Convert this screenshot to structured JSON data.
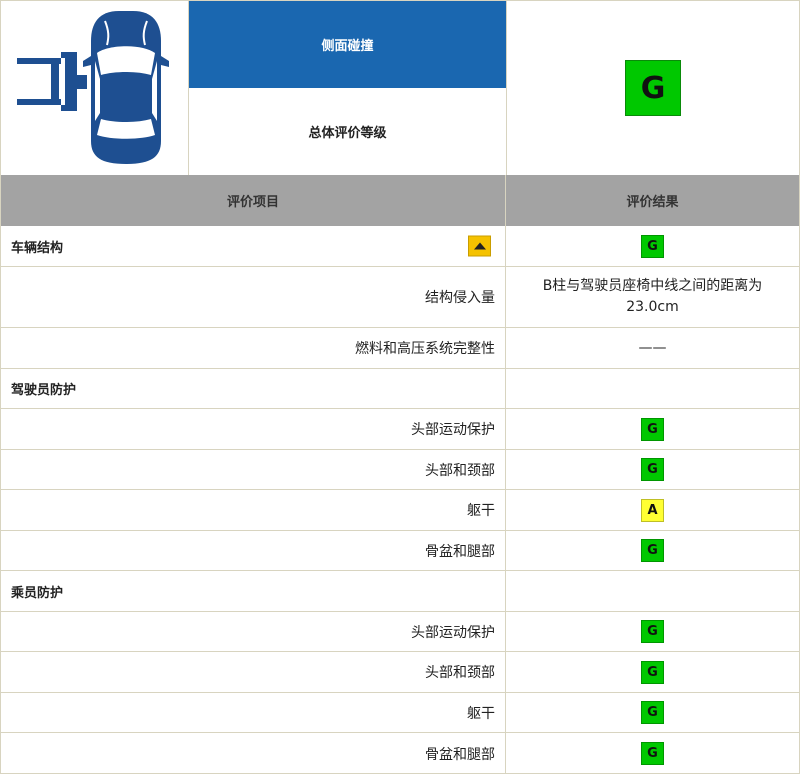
{
  "header": {
    "title": "侧面碰撞",
    "subtitle": "总体评价等级",
    "overall_rating": "G",
    "overall_color": "#00c800"
  },
  "columns": {
    "item": "评价项目",
    "result": "评价结果"
  },
  "rows": [
    {
      "type": "section",
      "label": "车辆结构",
      "rating": "G",
      "color": "#00c800",
      "has_warning": true
    },
    {
      "type": "item",
      "label": "结构侵入量",
      "text": "B柱与驾驶员座椅中线之间的距离为23.0cm"
    },
    {
      "type": "item",
      "label": "燃料和高压系统完整性",
      "text": "——"
    },
    {
      "type": "section",
      "label": "驾驶员防护"
    },
    {
      "type": "item",
      "label": "头部运动保护",
      "rating": "G",
      "color": "#00c800"
    },
    {
      "type": "item",
      "label": "头部和颈部",
      "rating": "G",
      "color": "#00c800"
    },
    {
      "type": "item",
      "label": "躯干",
      "rating": "A",
      "color": "#ffff33"
    },
    {
      "type": "item",
      "label": "骨盆和腿部",
      "rating": "G",
      "color": "#00c800"
    },
    {
      "type": "section",
      "label": "乘员防护"
    },
    {
      "type": "item",
      "label": "头部运动保护",
      "rating": "G",
      "color": "#00c800"
    },
    {
      "type": "item",
      "label": "头部和颈部",
      "rating": "G",
      "color": "#00c800"
    },
    {
      "type": "item",
      "label": "躯干",
      "rating": "G",
      "color": "#00c800"
    },
    {
      "type": "item",
      "label": "骨盆和腿部",
      "rating": "G",
      "color": "#00c800"
    }
  ],
  "icons": {
    "car": "side-impact-car-icon",
    "warning": "warning-triangle-icon"
  }
}
